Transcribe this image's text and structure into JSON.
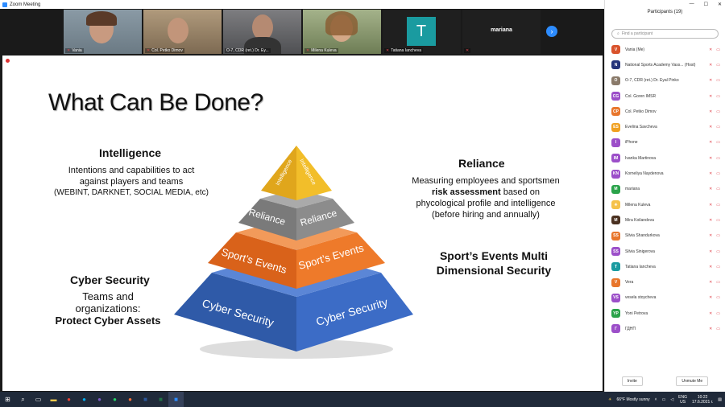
{
  "window": {
    "title": "Zoom Meeting"
  },
  "gallery": {
    "tiles": [
      {
        "name": "Vania",
        "class": "p1"
      },
      {
        "name": "Col. Petko Dimov",
        "class": "p2"
      },
      {
        "name": "O-7, CDR (ret.) Dr. Ey...",
        "class": "p3"
      },
      {
        "name": "Milena Kuleva",
        "class": "p4"
      }
    ],
    "avatar_tile": {
      "letter": "T",
      "name": "Tatiana Iancheva",
      "color": "#1a9ba0"
    },
    "name_tile": {
      "name": "mariana"
    }
  },
  "slide": {
    "title": "What Can Be Done?",
    "intelligence": {
      "heading": "Intelligence",
      "line1": "Intentions and capabilities to act",
      "line2": "against players and teams",
      "line3": "(WEBINT, DARKNET, SOCIAL MEDIA, etc)"
    },
    "reliance": {
      "heading": "Reliance",
      "line1": "Measuring employees and sportsmen",
      "bold": "risk assessment",
      "line2b": " based on",
      "line3": "phycological profile and intelligence",
      "line4": "(before hiring and annually)"
    },
    "sport": {
      "line1": "Sport’s Events Multi",
      "line2": "Dimensional Security"
    },
    "cyber": {
      "heading": "Cyber Security",
      "line1": "Teams and",
      "line2": "organizations:",
      "line3": "Protect Cyber Assets"
    },
    "pyramid": {
      "top_l": "Intelligence",
      "top_r": "Intelligence",
      "l2_l": "Reliance",
      "l2_r": "Reliance",
      "l3_l": "Sport’s Events",
      "l3_r": "Sport’s Events",
      "l4_l": "Cyber Security",
      "l4_r": "Cyber Security"
    }
  },
  "sidebar": {
    "title": "Participants (19)",
    "search_placeholder": "Find a participant",
    "invite": "Invite",
    "unmute": "Unmute Me",
    "participants": [
      {
        "initials": "V",
        "name": "Vania (Me)",
        "color": "#d9532c"
      },
      {
        "initials": "N",
        "name": "National Sports Academy Vass... (Host)",
        "color": "#24337a"
      },
      {
        "initials": "O",
        "name": "O-7, CDR (ret.) Dr. Eyal Pinko",
        "color": "#8a7a6a"
      },
      {
        "initials": "CG",
        "name": "Col. Goren IMSR",
        "color": "#9c4fc9"
      },
      {
        "initials": "CP",
        "name": "Col. Petko Dimov",
        "color": "#e8762c"
      },
      {
        "initials": "ES",
        "name": "Evelina Savcheva",
        "color": "#f0a020"
      },
      {
        "initials": "I",
        "name": "iPhone",
        "color": "#9c4fc9"
      },
      {
        "initials": "IM",
        "name": "Ivanka Martinova",
        "color": "#9c4fc9"
      },
      {
        "initials": "KN",
        "name": "Korneliya Naydenova",
        "color": "#9c4fc9"
      },
      {
        "initials": "M",
        "name": "mariana",
        "color": "#2aa34a"
      },
      {
        "initials": "☀",
        "name": "Milena Kuleva",
        "color": "#f5c24a"
      },
      {
        "initials": "M",
        "name": "Mira Koilandova",
        "color": "#4a3020"
      },
      {
        "initials": "SS",
        "name": "Silvia Shandurkova",
        "color": "#e8762c"
      },
      {
        "initials": "SS",
        "name": "Silvia Sinigerova",
        "color": "#9c4fc9"
      },
      {
        "initials": "T",
        "name": "Tatiana Iancheva",
        "color": "#1a9ba0"
      },
      {
        "initials": "V",
        "name": "Vera",
        "color": "#e8762c"
      },
      {
        "initials": "VS",
        "name": "vesela stoycheva",
        "color": "#9c4fc9"
      },
      {
        "initials": "YP",
        "name": "Yoni Petrova",
        "color": "#2aa34a"
      },
      {
        "initials": "Г",
        "name": "ГДНП",
        "color": "#9c4fc9"
      }
    ]
  },
  "taskbar": {
    "weather": "66°F  Mostly sunny",
    "lang": "ENG",
    "lang2": "US",
    "time": "10:22",
    "date": "17.6.2021 г."
  }
}
